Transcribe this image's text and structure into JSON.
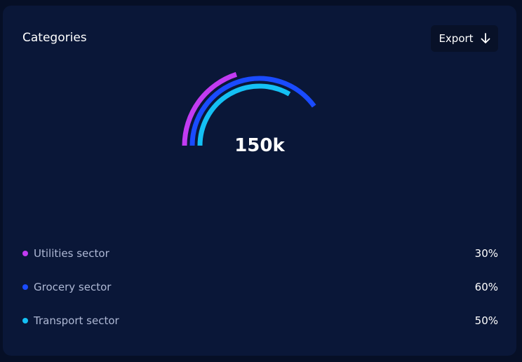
{
  "card": {
    "title": "Categories",
    "export_label": "Export",
    "export_icon": "arrow-down-icon"
  },
  "colors": {
    "background": "#060f26",
    "card": "#0a1738",
    "utilities": "#c23bf2",
    "grocery": "#1a4bff",
    "transport": "#14c0f4"
  },
  "chart_data": {
    "type": "radial-bar",
    "center_label": "150k",
    "max_value": 100,
    "series": [
      {
        "name": "Utilities sector",
        "value": 30,
        "label": "30%",
        "color": "#c23bf2"
      },
      {
        "name": "Grocery sector",
        "value": 60,
        "label": "60%",
        "color": "#1a4bff"
      },
      {
        "name": "Transport sector",
        "value": 50,
        "label": "50%",
        "color": "#14c0f4"
      }
    ]
  }
}
